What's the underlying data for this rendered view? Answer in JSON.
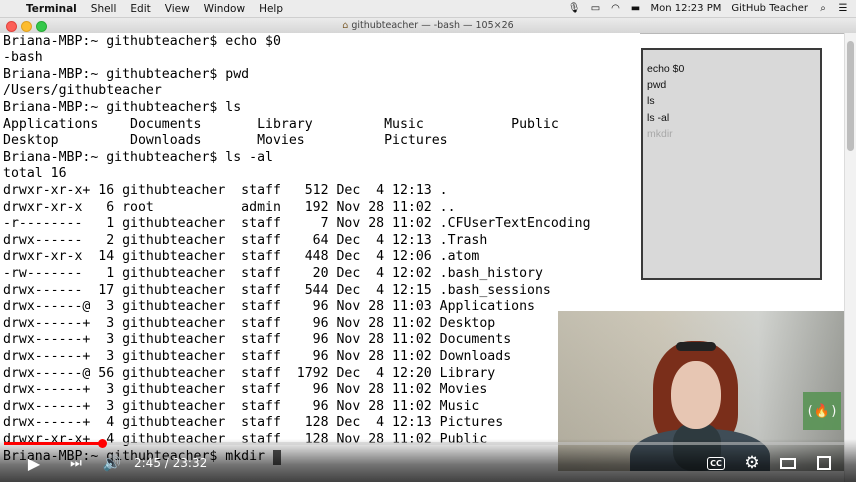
{
  "menubar": {
    "apple": "",
    "app_name": "Terminal",
    "items": [
      "Shell",
      "Edit",
      "View",
      "Window",
      "Help"
    ],
    "clock": "Mon 12:23 PM",
    "user": "GitHub Teacher"
  },
  "window": {
    "title": "githubteacher — -bash — 105×26",
    "home_icon": "⌂"
  },
  "terminal_lines": [
    "Briana-MBP:~ githubteacher$ echo $0",
    "-bash",
    "Briana-MBP:~ githubteacher$ pwd",
    "/Users/githubteacher",
    "Briana-MBP:~ githubteacher$ ls",
    "Applications    Documents       Library         Music           Public",
    "Desktop         Downloads       Movies          Pictures",
    "Briana-MBP:~ githubteacher$ ls -al",
    "total 16",
    "drwxr-xr-x+ 16 githubteacher  staff   512 Dec  4 12:13 .",
    "drwxr-xr-x   6 root           admin   192 Nov 28 11:02 ..",
    "-r--------   1 githubteacher  staff     7 Nov 28 11:02 .CFUserTextEncoding",
    "drwx------   2 githubteacher  staff    64 Dec  4 12:13 .Trash",
    "drwxr-xr-x  14 githubteacher  staff   448 Dec  4 12:06 .atom",
    "-rw-------   1 githubteacher  staff    20 Dec  4 12:02 .bash_history",
    "drwx------  17 githubteacher  staff   544 Dec  4 12:15 .bash_sessions",
    "drwx------@  3 githubteacher  staff    96 Nov 28 11:03 Applications",
    "drwx------+  3 githubteacher  staff    96 Nov 28 11:02 Desktop",
    "drwx------+  3 githubteacher  staff    96 Nov 28 11:02 Documents",
    "drwx------+  3 githubteacher  staff    96 Nov 28 11:02 Downloads",
    "drwx------@ 56 githubteacher  staff  1792 Dec  4 12:20 Library",
    "drwx------+  3 githubteacher  staff    96 Nov 28 11:02 Movies",
    "drwx------+  3 githubteacher  staff    96 Nov 28 11:02 Music",
    "drwx------+  4 githubteacher  staff   128 Dec  4 12:13 Pictures",
    "drwxr-xr-x+  4 githubteacher  staff   128 Nov 28 11:02 Public",
    "Briana-MBP:~ githubteacher$ mkdir "
  ],
  "notes": {
    "items": [
      "echo $0",
      "pwd",
      "ls",
      "ls -al"
    ],
    "upcoming": "mkdir"
  },
  "player": {
    "current_time": "2:45",
    "duration": "23:32",
    "time_separator": " / ",
    "progress_fraction": 0.117,
    "colors": {
      "progress": "#ff0000",
      "badge": "#5b9457"
    },
    "icons": {
      "play": "▶",
      "next": "⏭",
      "volume": "🔊",
      "cc": "CC",
      "settings": "⚙",
      "theater": "theater-mode-icon",
      "fullscreen": "fullscreen-icon",
      "badge": "(🔥)"
    }
  }
}
